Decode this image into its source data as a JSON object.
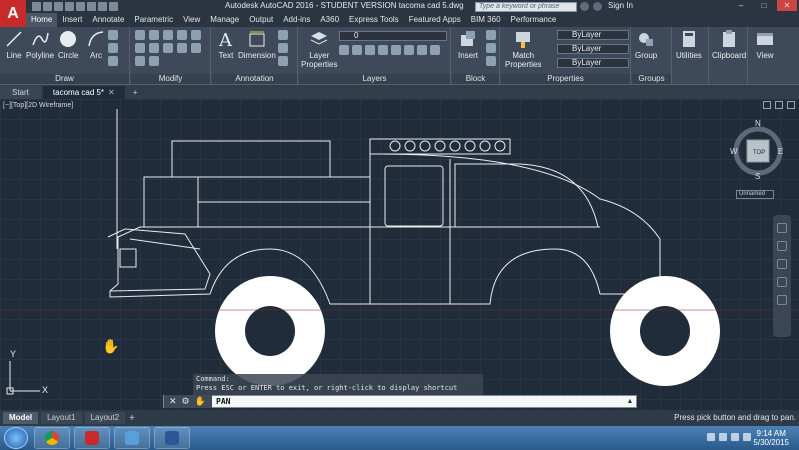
{
  "app": {
    "logo_letter": "A",
    "title": "Autodesk AutoCAD 2016 - STUDENT VERSION    tacoma cad 5.dwg",
    "search_placeholder": "Type a keyword or phrase",
    "sign_in": "Sign In"
  },
  "ribbon_tabs": [
    "Home",
    "Insert",
    "Annotate",
    "Parametric",
    "View",
    "Manage",
    "Output",
    "Add-ins",
    "A360",
    "Express Tools",
    "Featured Apps",
    "BIM 360",
    "Performance"
  ],
  "ribbon": {
    "draw": {
      "label": "Draw",
      "line": "Line",
      "polyline": "Polyline",
      "circle": "Circle",
      "arc": "Arc"
    },
    "modify": {
      "label": "Modify"
    },
    "annotation": {
      "label": "Annotation",
      "text": "Text",
      "dimension": "Dimension"
    },
    "layers": {
      "label": "Layers",
      "layer_properties_1": "Layer",
      "layer_properties_2": "Properties",
      "current_layer": "0"
    },
    "block": {
      "label": "Block",
      "insert": "Insert"
    },
    "properties": {
      "label": "Properties",
      "match_1": "Match",
      "match_2": "Properties",
      "color": "ByLayer",
      "linetype": "ByLayer",
      "lineweight": "ByLayer"
    },
    "groups": {
      "label": "Groups",
      "group": "Group"
    },
    "utilities": "Utilities",
    "clipboard": "Clipboard",
    "view": "View"
  },
  "file_tabs": [
    {
      "label": "Start"
    },
    {
      "label": "tacoma cad 5*"
    }
  ],
  "viewport": {
    "label": "[−][Top][2D Wireframe]",
    "viewcube": {
      "n": "N",
      "s": "S",
      "e": "E",
      "w": "W",
      "face": "TOP"
    },
    "ucs_name": "Unnamed",
    "ucs_x": "X",
    "ucs_y": "Y"
  },
  "command": {
    "history_1": "Command:",
    "history_2": "Press ESC or ENTER to exit, or right-click to display shortcut menu.",
    "current": "PAN"
  },
  "layout_tabs": [
    "Model",
    "Layout1",
    "Layout2"
  ],
  "status_message": "Press pick button and drag to pan.",
  "taskbar": {
    "time": "9:14 AM",
    "date": "5/30/2015"
  },
  "colors": {
    "autocad_red": "#c62a2a",
    "ribbon_bg": "#3e4a59",
    "canvas_bg": "#212c3a",
    "wheel_fill": "#ffffff"
  }
}
